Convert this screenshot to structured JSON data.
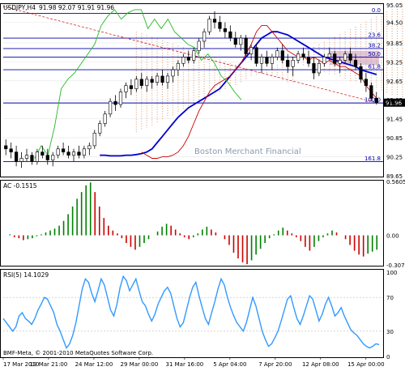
{
  "chart_data": [
    {
      "type": "candlestick",
      "symbol_label": "USDJPY,H4",
      "ohlc_label": "91.98 92.07 91.91 91.96",
      "watermark": "Boston Merchant Financial",
      "ylim": [
        89.65,
        95.05
      ],
      "y_ticks": [
        "95.05",
        "94.50",
        "93.85",
        "93.25",
        "92.65",
        "92.05",
        "91.45",
        "90.85",
        "90.25",
        "89.65"
      ],
      "current_price": "91.96",
      "fib_levels": [
        {
          "label": "0.0",
          "price": 94.78
        },
        {
          "label": "23.6",
          "price": 94.0
        },
        {
          "label": "38.2",
          "price": 93.67
        },
        {
          "label": "50.0",
          "price": 93.4
        },
        {
          "label": "61.8",
          "price": 93.0
        },
        {
          "label": "100.0",
          "price": 91.95
        },
        {
          "label": "161.8",
          "price": 90.1
        }
      ],
      "candles": [
        [
          90.6,
          90.8,
          90.3,
          90.5
        ],
        [
          90.5,
          90.7,
          90.2,
          90.4
        ],
        [
          90.4,
          90.6,
          89.95,
          90.1
        ],
        [
          90.1,
          90.4,
          89.9,
          90.2
        ],
        [
          90.2,
          90.5,
          90.1,
          90.3
        ],
        [
          90.3,
          90.4,
          90.0,
          90.1
        ],
        [
          90.1,
          90.5,
          90.0,
          90.4
        ],
        [
          90.4,
          90.6,
          90.2,
          90.3
        ],
        [
          90.3,
          90.5,
          90.0,
          90.15
        ],
        [
          90.15,
          90.4,
          89.95,
          90.3
        ],
        [
          90.3,
          90.6,
          90.2,
          90.5
        ],
        [
          90.5,
          90.7,
          90.3,
          90.4
        ],
        [
          90.4,
          90.6,
          90.2,
          90.3
        ],
        [
          90.3,
          90.5,
          90.1,
          90.4
        ],
        [
          90.4,
          90.6,
          90.2,
          90.3
        ],
        [
          90.3,
          90.6,
          90.2,
          90.5
        ],
        [
          90.5,
          90.7,
          90.3,
          90.6
        ],
        [
          90.6,
          91.1,
          90.5,
          91.0
        ],
        [
          91.0,
          91.4,
          90.9,
          91.3
        ],
        [
          91.3,
          91.7,
          91.2,
          91.6
        ],
        [
          91.6,
          92.1,
          91.5,
          92.0
        ],
        [
          92.0,
          92.2,
          91.7,
          91.9
        ],
        [
          91.9,
          92.4,
          91.8,
          92.3
        ],
        [
          92.3,
          92.6,
          92.1,
          92.5
        ],
        [
          92.5,
          92.7,
          92.2,
          92.4
        ],
        [
          92.4,
          92.8,
          92.3,
          92.7
        ],
        [
          92.7,
          92.9,
          92.4,
          92.5
        ],
        [
          92.5,
          92.8,
          92.3,
          92.7
        ],
        [
          92.7,
          92.8,
          92.4,
          92.6
        ],
        [
          92.6,
          92.9,
          92.5,
          92.8
        ],
        [
          92.8,
          93.0,
          92.5,
          92.6
        ],
        [
          92.6,
          92.9,
          92.4,
          92.8
        ],
        [
          92.8,
          93.1,
          92.6,
          93.0
        ],
        [
          93.0,
          93.3,
          92.8,
          93.2
        ],
        [
          93.2,
          93.5,
          93.1,
          93.4
        ],
        [
          93.4,
          93.6,
          93.2,
          93.3
        ],
        [
          93.3,
          93.7,
          93.2,
          93.6
        ],
        [
          93.6,
          94.0,
          93.5,
          93.9
        ],
        [
          93.9,
          94.3,
          93.7,
          94.2
        ],
        [
          94.2,
          94.7,
          94.1,
          94.6
        ],
        [
          94.6,
          94.85,
          94.3,
          94.5
        ],
        [
          94.5,
          94.7,
          94.2,
          94.3
        ],
        [
          94.3,
          94.5,
          94.0,
          94.2
        ],
        [
          94.2,
          94.4,
          93.9,
          94.0
        ],
        [
          94.0,
          94.2,
          93.7,
          93.8
        ],
        [
          93.8,
          94.1,
          93.6,
          94.0
        ],
        [
          94.0,
          94.1,
          93.4,
          93.5
        ],
        [
          93.5,
          93.8,
          93.3,
          93.7
        ],
        [
          93.7,
          93.8,
          93.1,
          93.2
        ],
        [
          93.2,
          93.5,
          92.9,
          93.4
        ],
        [
          93.4,
          93.6,
          93.1,
          93.2
        ],
        [
          93.2,
          93.5,
          93.0,
          93.4
        ],
        [
          93.4,
          93.7,
          93.3,
          93.6
        ],
        [
          93.6,
          93.8,
          93.2,
          93.3
        ],
        [
          93.3,
          93.5,
          92.9,
          93.1
        ],
        [
          93.1,
          93.4,
          92.8,
          93.3
        ],
        [
          93.3,
          93.6,
          93.2,
          93.5
        ],
        [
          93.5,
          93.7,
          93.3,
          93.4
        ],
        [
          93.4,
          93.6,
          93.1,
          93.2
        ],
        [
          93.2,
          93.4,
          92.7,
          92.9
        ],
        [
          92.9,
          93.3,
          92.8,
          93.2
        ],
        [
          93.2,
          93.5,
          93.1,
          93.4
        ],
        [
          93.4,
          93.7,
          93.3,
          93.5
        ],
        [
          93.5,
          93.6,
          93.1,
          93.2
        ],
        [
          93.2,
          93.4,
          92.9,
          93.3
        ],
        [
          93.3,
          93.6,
          93.2,
          93.5
        ],
        [
          93.5,
          93.7,
          93.2,
          93.3
        ],
        [
          93.3,
          93.5,
          93.0,
          93.1
        ],
        [
          93.1,
          93.2,
          92.6,
          92.7
        ],
        [
          92.7,
          92.9,
          92.3,
          92.5
        ],
        [
          92.5,
          92.6,
          92.0,
          92.1
        ],
        [
          92.1,
          92.3,
          91.9,
          91.96
        ]
      ],
      "series": [
        {
          "name": "MA",
          "color": "#0000cc",
          "values": [
            90.3,
            90.3,
            90.28,
            90.28,
            90.28,
            90.3,
            90.3,
            90.32,
            90.35,
            90.4,
            90.5,
            90.7,
            90.9,
            91.1,
            91.3,
            91.5,
            91.65,
            91.8,
            91.9,
            92.0,
            92.1,
            92.2,
            92.3,
            92.4,
            92.6,
            92.8,
            93.0,
            93.2,
            93.4,
            93.6,
            93.8,
            94.0,
            94.1,
            94.2,
            94.2,
            94.15,
            94.1,
            94.0,
            93.9,
            93.8,
            93.7,
            93.6,
            93.5,
            93.4,
            93.35,
            93.3,
            93.25,
            93.2,
            93.15,
            93.1,
            93.0,
            92.95,
            92.9,
            92.85
          ]
        },
        {
          "name": "MA",
          "color": "#cc0000",
          "values": [
            90.4,
            90.3,
            90.2,
            90.2,
            90.25,
            90.25,
            90.3,
            90.4,
            90.6,
            90.9,
            91.3,
            91.7,
            92.0,
            92.3,
            92.5,
            92.6,
            92.7,
            92.8,
            93.0,
            93.2,
            93.5,
            93.8,
            94.2,
            94.4,
            94.4,
            94.2,
            94.0,
            93.8,
            93.6,
            93.5,
            93.4,
            93.4,
            93.3,
            93.4,
            93.3,
            93.2,
            93.3,
            93.2,
            93.1,
            93.1,
            93.0,
            92.9,
            92.8,
            92.5,
            92.3,
            92.1
          ]
        },
        {
          "name": "Chikou",
          "color": "#22bb22",
          "values": [
            90.2,
            90.6,
            90.3,
            91.2,
            92.4,
            92.7,
            92.9,
            93.2,
            93.5,
            93.8,
            94.4,
            94.7,
            94.9,
            94.6,
            94.8,
            94.9,
            94.9,
            94.3,
            94.6,
            94.3,
            94.6,
            94.2,
            94.0,
            93.8,
            93.7,
            93.3,
            93.5,
            93.2,
            92.8,
            92.6,
            92.3,
            92.05
          ]
        }
      ]
    },
    {
      "type": "bar",
      "title": "AC -0.1515",
      "ylim": [
        -0.3074,
        0.5605
      ],
      "y_ticks": [
        "0.5605",
        "0.00",
        "-0.3074"
      ],
      "values": [
        0.0,
        0.01,
        -0.02,
        -0.03,
        -0.05,
        -0.04,
        -0.03,
        -0.01,
        0.01,
        0.03,
        0.05,
        0.07,
        0.1,
        0.15,
        0.22,
        0.3,
        0.38,
        0.45,
        0.52,
        0.55,
        0.45,
        0.3,
        0.18,
        0.1,
        0.05,
        0.02,
        -0.03,
        -0.08,
        -0.12,
        -0.15,
        -0.12,
        -0.08,
        -0.04,
        0.0,
        0.04,
        0.09,
        0.12,
        0.1,
        0.06,
        0.02,
        -0.02,
        -0.04,
        -0.02,
        0.02,
        0.06,
        0.09,
        0.06,
        0.03,
        0.0,
        -0.04,
        -0.1,
        -0.18,
        -0.24,
        -0.28,
        -0.3,
        -0.26,
        -0.2,
        -0.14,
        -0.08,
        -0.03,
        0.01,
        0.05,
        0.08,
        0.05,
        0.02,
        -0.02,
        -0.06,
        -0.12,
        -0.16,
        -0.12,
        -0.06,
        -0.02,
        0.02,
        0.05,
        0.03,
        0.0,
        -0.04,
        -0.1,
        -0.16,
        -0.2,
        -0.22,
        -0.19,
        -0.17,
        -0.15
      ]
    },
    {
      "type": "line",
      "title": "RSI(5) 14.1029",
      "ylim": [
        0,
        100
      ],
      "y_ticks": [
        "100",
        "70",
        "30",
        "0"
      ],
      "series": [
        {
          "name": "RSI(5)",
          "color": "#3399ff",
          "values": [
            45,
            40,
            35,
            30,
            35,
            48,
            52,
            45,
            42,
            38,
            45,
            55,
            62,
            70,
            68,
            60,
            52,
            38,
            30,
            20,
            10,
            15,
            25,
            40,
            60,
            80,
            92,
            88,
            75,
            65,
            78,
            92,
            85,
            70,
            55,
            48,
            62,
            82,
            95,
            90,
            78,
            85,
            92,
            78,
            65,
            60,
            50,
            42,
            50,
            62,
            70,
            78,
            82,
            75,
            60,
            45,
            35,
            40,
            55,
            70,
            82,
            88,
            72,
            58,
            45,
            38,
            52,
            65,
            80,
            92,
            85,
            70,
            58,
            48,
            40,
            35,
            30,
            40,
            55,
            70,
            60,
            45,
            30,
            20,
            12,
            15,
            22,
            30,
            42,
            55,
            68,
            72,
            58,
            45,
            38,
            48,
            60,
            72,
            68,
            55,
            42,
            50,
            62,
            70,
            60,
            48,
            52,
            58,
            48,
            40,
            32,
            28,
            25,
            20,
            15,
            12,
            10,
            12,
            15,
            14
          ]
        }
      ]
    }
  ],
  "x_labels": [
    "17 Mar 2010",
    "19 Mar 21:00",
    "24 Mar 12:00",
    "29 Mar 00:00",
    "31 Mar 16:00",
    "5 Apr 04:00",
    "7 Apr 20:00",
    "12 Apr 08:00",
    "15 Apr 00:00"
  ],
  "copyright": "BMF-Meta, © 2001-2010 MetaQuotes Software Corp.",
  "colors": {
    "up": "#008000",
    "down": "#cc0000",
    "cloud": "#e0a882",
    "cloud_flat": "#c896b4"
  }
}
